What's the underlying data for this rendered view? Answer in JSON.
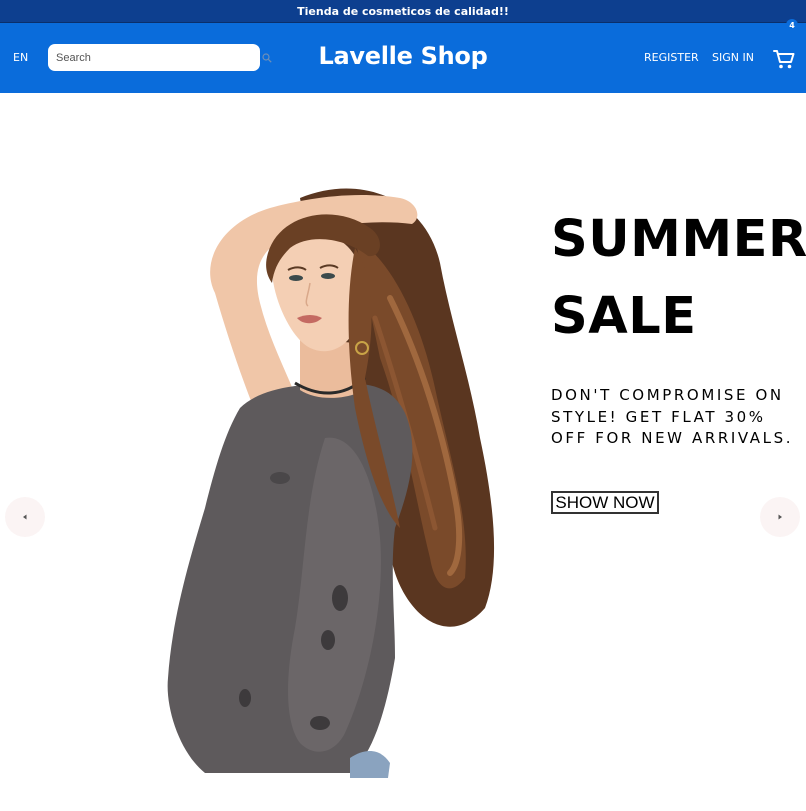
{
  "announcement": {
    "text": "Tienda de cosmeticos de calidad!!"
  },
  "header": {
    "language": "EN",
    "search": {
      "placeholder": "Search",
      "value": ""
    },
    "logo": "Lavelle Shop",
    "register_label": "REGISTER",
    "signin_label": "SIGN IN",
    "cart": {
      "icon": "cart-icon",
      "count": "4"
    }
  },
  "slider": {
    "title_line1": "SUMMER",
    "title_line2": "SALE",
    "description": "DON'T COMPROMISE ON STYLE! GET FLAT 30% OFF FOR NEW ARRIVALS.",
    "button_label": "SHOW NOW",
    "left_arrow_icon": "arrow-left-icon",
    "right_arrow_icon": "arrow-right-icon",
    "image": "model-photo"
  },
  "colors": {
    "announcement_bg": "#0d3f8f",
    "navbar_bg": "#0a6cdb",
    "arrow_bg": "#fbf4f4",
    "text": "#000000"
  }
}
